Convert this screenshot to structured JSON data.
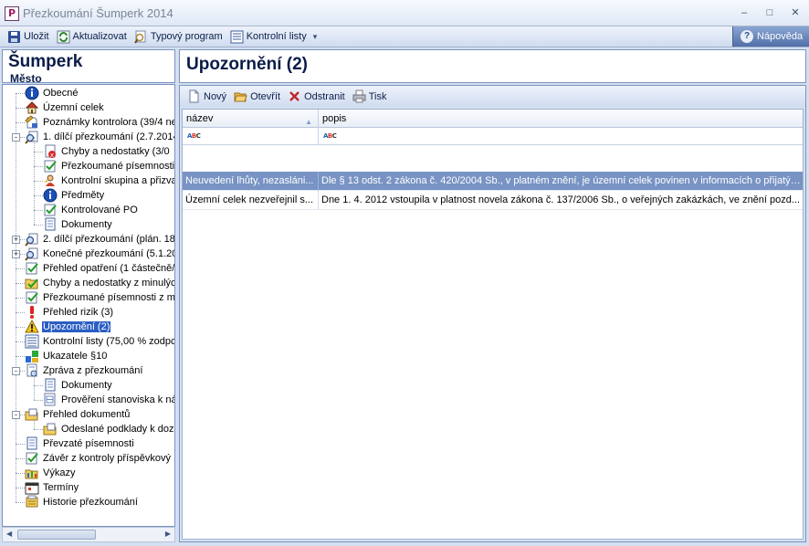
{
  "window": {
    "title": "Přezkoumání Šumperk 2014",
    "app_icon_letter": "P",
    "min": "–",
    "max": "□",
    "close": "✕"
  },
  "toolbar": {
    "save": "Uložit",
    "refresh": "Aktualizovat",
    "template": "Typový program",
    "checklists": "Kontrolní listy",
    "dropdown": "▾",
    "help": "Nápověda"
  },
  "left": {
    "title": "Šumperk",
    "subtitle": "Město"
  },
  "tree": [
    {
      "label": "Obecné",
      "icon": "info-icon"
    },
    {
      "label": "Územní celek",
      "icon": "house-icon"
    },
    {
      "label": "Poznámky kontrolora (39/4 ne",
      "icon": "notes-icon"
    },
    {
      "label": "1. dílčí přezkoumání (2.7.2014",
      "icon": "review-icon"
    },
    {
      "label": "Chyby a nedostatky (3/0",
      "icon": "error-doc-icon"
    },
    {
      "label": "Přezkoumané písemnosti (",
      "icon": "checked-doc-icon"
    },
    {
      "label": "Kontrolní skupina a přizvar",
      "icon": "group-icon"
    },
    {
      "label": "Předměty",
      "icon": "info-icon"
    },
    {
      "label": "Kontrolované PO",
      "icon": "checked-doc-icon"
    },
    {
      "label": "Dokumenty",
      "icon": "doc-icon"
    },
    {
      "label": "2. dílčí přezkoumání (plán. 18.",
      "icon": "review-icon"
    },
    {
      "label": "Konečné přezkoumání (5.1.20",
      "icon": "review-icon"
    },
    {
      "label": "Přehled opatření (1 částečně/",
      "icon": "checked-doc-icon"
    },
    {
      "label": "Chyby a nedostatky z minulýc",
      "icon": "folder-check-icon"
    },
    {
      "label": "Přezkoumané písemnosti z mir",
      "icon": "checked-doc-icon"
    },
    {
      "label": "Přehled rizik (3)",
      "icon": "exclamation-icon"
    },
    {
      "label": "Upozornění (2)",
      "icon": "warning-icon"
    },
    {
      "label": "Kontrolní listy (75,00 % zodpc",
      "icon": "list-icon"
    },
    {
      "label": "Ukazatele §10",
      "icon": "indicators-icon"
    },
    {
      "label": "Zpráva z přezkoumání",
      "icon": "report-icon"
    },
    {
      "label": "Dokumenty",
      "icon": "doc-icon"
    },
    {
      "label": "Prověření stanoviska k ná",
      "icon": "table-doc-icon"
    },
    {
      "label": "Přehled dokumentů",
      "icon": "folder-docs-icon"
    },
    {
      "label": "Odeslané podklady k dozo",
      "icon": "folder-docs-icon"
    },
    {
      "label": "Převzaté písemnosti",
      "icon": "doc-icon"
    },
    {
      "label": "Závěr z kontroly příspěvkový",
      "icon": "checked-doc-icon"
    },
    {
      "label": "Výkazy",
      "icon": "reports-folder-icon"
    },
    {
      "label": "Termíny",
      "icon": "calendar-icon"
    },
    {
      "label": "Historie přezkoumání",
      "icon": "history-icon"
    }
  ],
  "right": {
    "title": "Upozornění (2)",
    "actions": {
      "new": "Nový",
      "open": "Otevřít",
      "delete": "Odstranit",
      "print": "Tisk"
    },
    "columns": [
      "název",
      "popis"
    ],
    "rows": [
      [
        "Neuvedení lhůty, nezasláni...",
        "Dle § 13 odst. 2 zákona č. 420/2004 Sb., v platném znění, je územní celek povinen v informacích o přijatýc..."
      ],
      [
        "Územní celek nezveřejnil s...",
        "Dne 1. 4. 2012 vstoupila v platnost novela zákona č. 137/2006 Sb., o veřejných zakázkách, ve znění pozd..."
      ]
    ]
  }
}
